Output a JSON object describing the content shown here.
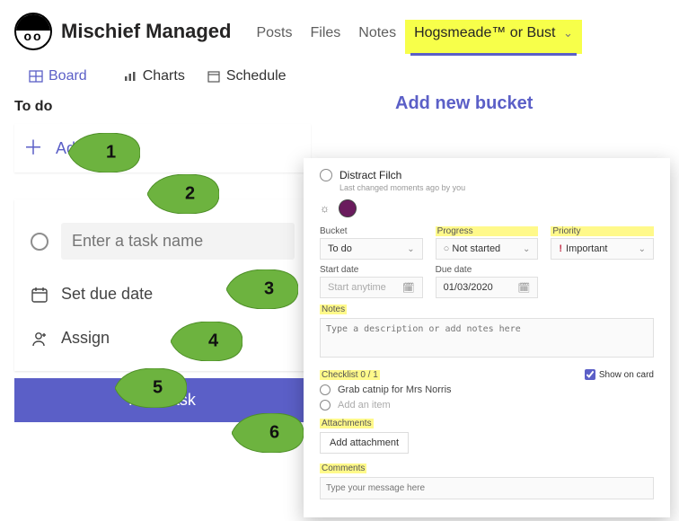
{
  "header": {
    "team_name": "Mischief Managed",
    "tabs": [
      {
        "label": "Posts"
      },
      {
        "label": "Files"
      },
      {
        "label": "Notes"
      },
      {
        "label": "Hogsmeade™ or Bust",
        "active": true
      }
    ]
  },
  "subnav": {
    "board": "Board",
    "charts": "Charts",
    "schedule": "Schedule"
  },
  "board": {
    "bucket_title": "To do",
    "add_bucket": "Add new bucket",
    "add_task_label": "Add task",
    "new_task": {
      "placeholder": "Enter a task name",
      "set_due": "Set due date",
      "assign": "Assign",
      "add_button": "Add Task"
    }
  },
  "callouts": [
    "1",
    "2",
    "3",
    "4",
    "5",
    "6"
  ],
  "panel": {
    "title": "Distract Filch",
    "meta": "Last changed moments ago by you",
    "labels": {
      "bucket": "Bucket",
      "progress": "Progress",
      "priority": "Priority",
      "start_date": "Start date",
      "due_date": "Due date",
      "notes": "Notes",
      "checklist": "Checklist 0 / 1",
      "attachments": "Attachments",
      "comments": "Comments"
    },
    "bucket_value": "To do",
    "progress_value": "Not started",
    "priority_value": "Important",
    "start_date_value": "Start anytime",
    "due_date_value": "01/03/2020",
    "notes_placeholder": "Type a description or add notes here",
    "show_on_card": "Show on card",
    "checklist_items": [
      "Grab catnip for Mrs Norris"
    ],
    "add_item": "Add an item",
    "add_attachment": "Add attachment",
    "comments_placeholder": "Type your message here"
  }
}
